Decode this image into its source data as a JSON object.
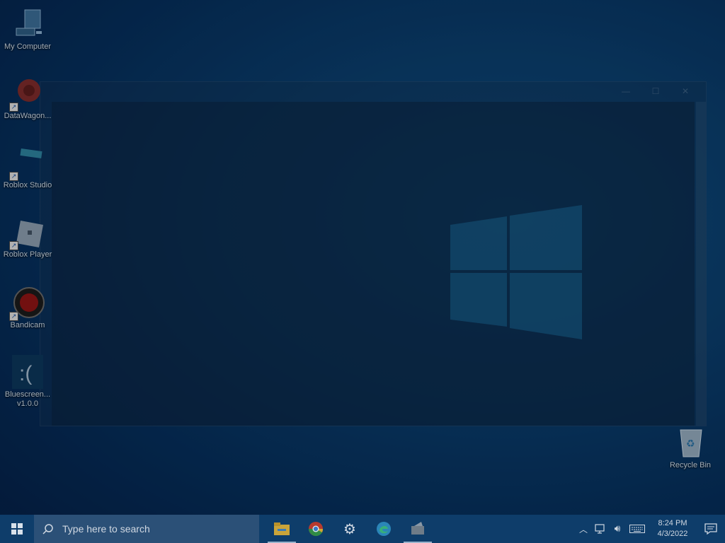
{
  "desktop_icons": [
    {
      "label": "My Computer",
      "icon": "computer-icon"
    },
    {
      "label": "DataWagon...",
      "icon": "datawagon-icon"
    },
    {
      "label": "Roblox Studio",
      "icon": "roblox-studio-icon"
    },
    {
      "label": "Roblox Player",
      "icon": "roblox-player-icon"
    },
    {
      "label": "Bandicam",
      "icon": "bandicam-icon"
    },
    {
      "label": "Bluescreen...",
      "label2": "v1.0.0",
      "icon": "bluescreen-icon"
    },
    {
      "label": "Recycle Bin",
      "icon": "recycle-bin-icon"
    }
  ],
  "window": {
    "title": "",
    "console_text": ""
  },
  "taskbar": {
    "search_placeholder": "Type here to search",
    "apps": [
      "file-explorer-icon",
      "chrome-icon",
      "settings-icon",
      "edge-icon",
      "app-icon"
    ]
  },
  "tray": {
    "time": "8:24 PM",
    "date": "4/3/2022"
  }
}
